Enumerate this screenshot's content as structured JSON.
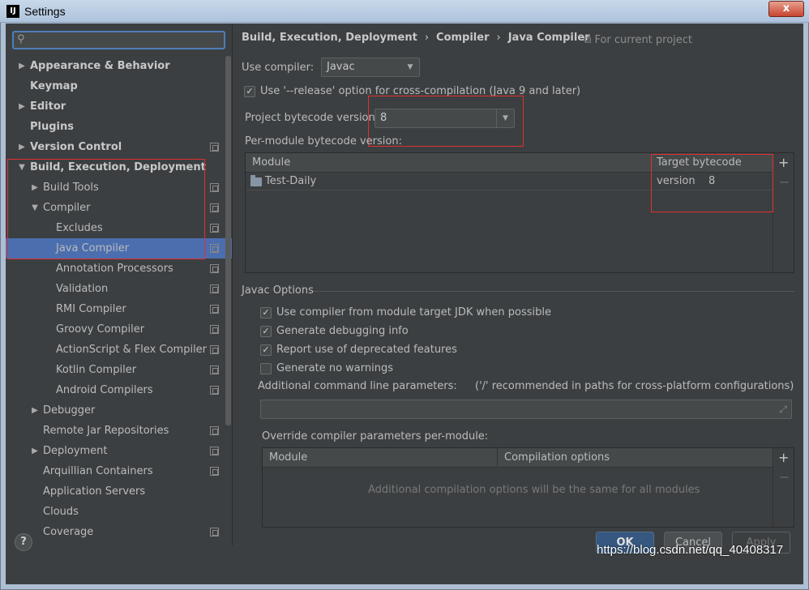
{
  "window": {
    "title": "Settings",
    "app_icon": "IJ",
    "close_glyph": "x"
  },
  "search": {
    "value": "",
    "icon": "search-icon"
  },
  "sidebar": {
    "items": [
      {
        "label": "Appearance & Behavior",
        "expander": "right",
        "bold": true
      },
      {
        "label": "Keymap",
        "bold": true
      },
      {
        "label": "Editor",
        "expander": "right",
        "bold": true
      },
      {
        "label": "Plugins",
        "bold": true
      },
      {
        "label": "Version Control",
        "expander": "right",
        "bold": true,
        "project": true
      },
      {
        "label": "Build, Execution, Deployment",
        "expander": "down",
        "bold": true
      },
      {
        "label": "Build Tools",
        "expander": "right",
        "project": true
      },
      {
        "label": "Compiler",
        "expander": "down",
        "project": true
      },
      {
        "label": "Excludes",
        "project": true
      },
      {
        "label": "Java Compiler",
        "project": true,
        "selected": true
      },
      {
        "label": "Annotation Processors",
        "project": true
      },
      {
        "label": "Validation",
        "project": true
      },
      {
        "label": "RMI Compiler",
        "project": true
      },
      {
        "label": "Groovy Compiler",
        "project": true
      },
      {
        "label": "ActionScript & Flex Compiler",
        "project": true
      },
      {
        "label": "Kotlin Compiler",
        "project": true
      },
      {
        "label": "Android Compilers",
        "project": true
      },
      {
        "label": "Debugger",
        "expander": "right"
      },
      {
        "label": "Remote Jar Repositories",
        "project": true
      },
      {
        "label": "Deployment",
        "expander": "right",
        "project": true
      },
      {
        "label": "Arquillian Containers",
        "project": true
      },
      {
        "label": "Application Servers"
      },
      {
        "label": "Clouds"
      },
      {
        "label": "Coverage",
        "project": true
      }
    ]
  },
  "breadcrumb": {
    "part1": "Build, Execution, Deployment",
    "part2": "Compiler",
    "part3": "Java Compiler",
    "sep": "›"
  },
  "for_project": "For current project",
  "use_compiler": {
    "label": "Use compiler:",
    "value": "Javac"
  },
  "release_option": {
    "label": "Use '--release' option for cross-compilation (Java 9 and later)",
    "checked": true
  },
  "project_bytecode": {
    "label": "Project bytecode version:",
    "value": "8"
  },
  "per_module": {
    "label": "Per-module bytecode version:",
    "columns": [
      "Module",
      "Target bytecode version"
    ],
    "rows": [
      {
        "module": "Test-Daily",
        "target": "8"
      }
    ]
  },
  "javac": {
    "section": "Javac Options",
    "options": [
      {
        "label": "Use compiler from module target JDK when possible",
        "checked": true
      },
      {
        "label": "Generate debugging info",
        "checked": true
      },
      {
        "label": "Report use of deprecated features",
        "checked": true
      },
      {
        "label": "Generate no warnings",
        "checked": false
      }
    ],
    "cmdline_label": "Additional command line parameters:",
    "cmdline_hint": "('/' recommended in paths for cross-platform configurations)",
    "cmdline_value": ""
  },
  "override": {
    "label": "Override compiler parameters per-module:",
    "columns": [
      "Module",
      "Compilation options"
    ],
    "empty": "Additional compilation options will be the same for all modules"
  },
  "buttons": {
    "ok": "OK",
    "cancel": "Cancel",
    "apply": "Apply",
    "help": "?"
  },
  "watermark": "https://blog.csdn.net/qq_40408317",
  "colors": {
    "selection": "#4b6eaf",
    "highlight_box": "#e03030",
    "background": "#3c3f41"
  }
}
